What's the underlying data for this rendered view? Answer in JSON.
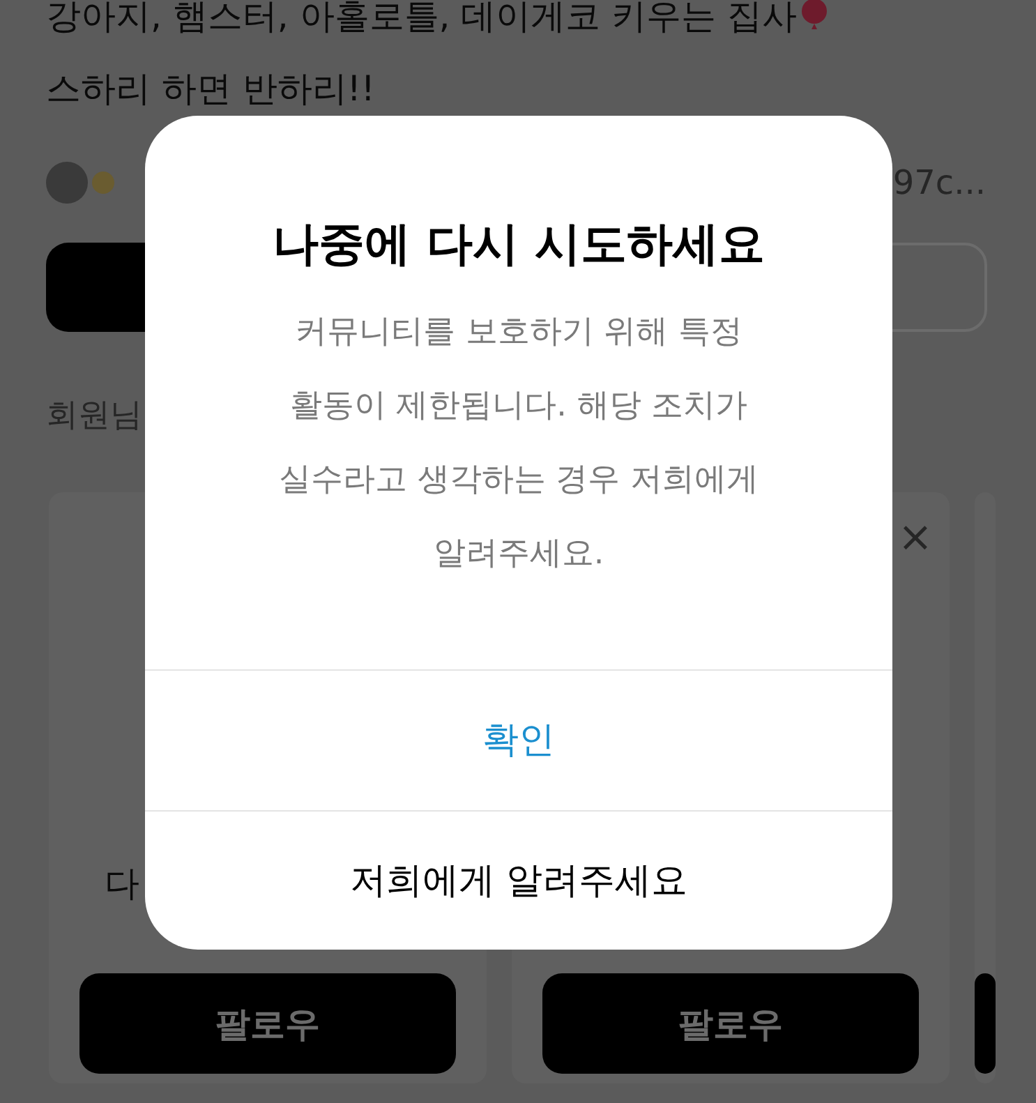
{
  "profile": {
    "bio_lines": [
      "강아지, 햄스터, 아홀로틀, 데이게코 키우는 집사",
      "스하리 하면 반하리!!"
    ],
    "followed_by": "97c...",
    "section_title": "회원님",
    "suggestions": [
      {
        "name": "다",
        "button": "팔로우"
      },
      {
        "dismiss": "×",
        "button": "팔로우"
      },
      {
        "kind": "partial"
      }
    ]
  },
  "dialog": {
    "title": "나중에 다시 시도하세요",
    "message": "커뮤니티를 보호하기 위해 특정 활동이 제한됩니다. 해당 조치가 실수라고 생각하는 경우 저희에게 알려주세요.",
    "actions": [
      {
        "label": "확인",
        "kind": "primary"
      },
      {
        "label": "저희에게 알려주세요",
        "kind": "plain"
      }
    ]
  }
}
